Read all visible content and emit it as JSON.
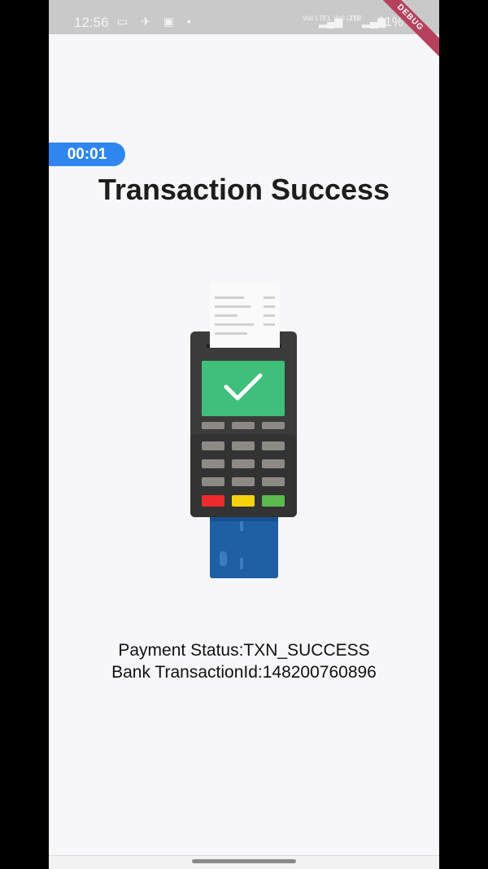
{
  "status_bar": {
    "time": "12:56",
    "notification_icons": "▭ ✈ ▣ •",
    "sim1_label": "Vo0 LTE1",
    "sim2_label": "Vo0 LTE2",
    "sim2_extra": "LTE",
    "battery": "61%"
  },
  "debug_banner": "DEBUG",
  "timer": "00:01",
  "title": "Transaction Success",
  "payment_status_line": "Payment Status:TXN_SUCCESS",
  "bank_txn_line": "Bank TransactionId:148200760896",
  "colors": {
    "accent": "#2f86f0",
    "success_screen": "#3fbf7a",
    "terminal": "#3b3b3b",
    "card": "#1f5fa5"
  }
}
